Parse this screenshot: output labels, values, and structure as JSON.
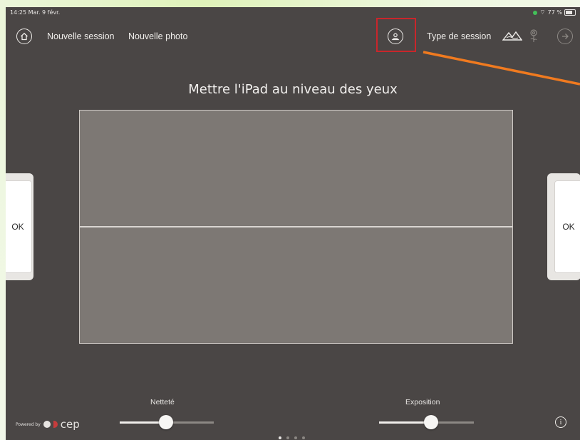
{
  "status_bar": {
    "time_date": "14:25  Mar. 9 févr.",
    "battery": "77 %"
  },
  "topbar": {
    "home_icon": "home-icon",
    "nouvelle_session": "Nouvelle session",
    "nouvelle_photo": "Nouvelle photo",
    "profile_icon": "user-icon",
    "type_de_session": "Type de session",
    "landscape_icon": "mountains-icon",
    "flower_icon": "flower-icon",
    "next_icon": "arrow-right-icon"
  },
  "instruction": "Mettre l'iPad au niveau des yeux",
  "side_buttons": {
    "left": "OK",
    "right": "OK"
  },
  "sliders": {
    "nettete": {
      "label": "Netteté",
      "value": 0.5
    },
    "exposition": {
      "label": "Exposition",
      "value": 0.55
    }
  },
  "footer": {
    "powered_by": "Powered by",
    "brand": "cep"
  },
  "pager": {
    "count": 4,
    "current": 1
  },
  "colors": {
    "annotation_box": "#c9262b",
    "annotation_arrow": "#f07a1f",
    "screen_bg": "#4a4645"
  }
}
